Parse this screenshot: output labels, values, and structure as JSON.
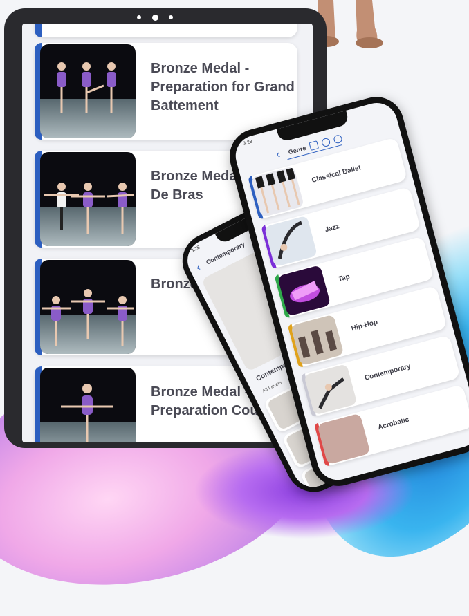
{
  "tablet": {
    "lessons": [
      {
        "title": "Bronze Medal - Preparation for Grand Battement"
      },
      {
        "title": "Bronze Medal - Port De Bras"
      },
      {
        "title": "Bronze Medal - Ballet"
      },
      {
        "title": "Bronze Medal - Preparation Coupé"
      }
    ]
  },
  "phone_genres": {
    "status_time": "3:28",
    "header_title": "Genre",
    "genres": [
      {
        "label": "Classical Ballet",
        "accent": "#2d5fc0"
      },
      {
        "label": "Jazz",
        "accent": "#7b2fd8"
      },
      {
        "label": "Tap",
        "accent": "#2ea84a"
      },
      {
        "label": "Hip-Hop",
        "accent": "#e0a21b"
      },
      {
        "label": "Contemporary",
        "accent": "#c9c9d4"
      },
      {
        "label": "Acrobatic",
        "accent": "#e04848"
      }
    ]
  },
  "phone_contemporary": {
    "status_time": "3:28",
    "header_title": "Contemporary",
    "section_title": "Contemporary",
    "filter_label": "All Levels"
  }
}
